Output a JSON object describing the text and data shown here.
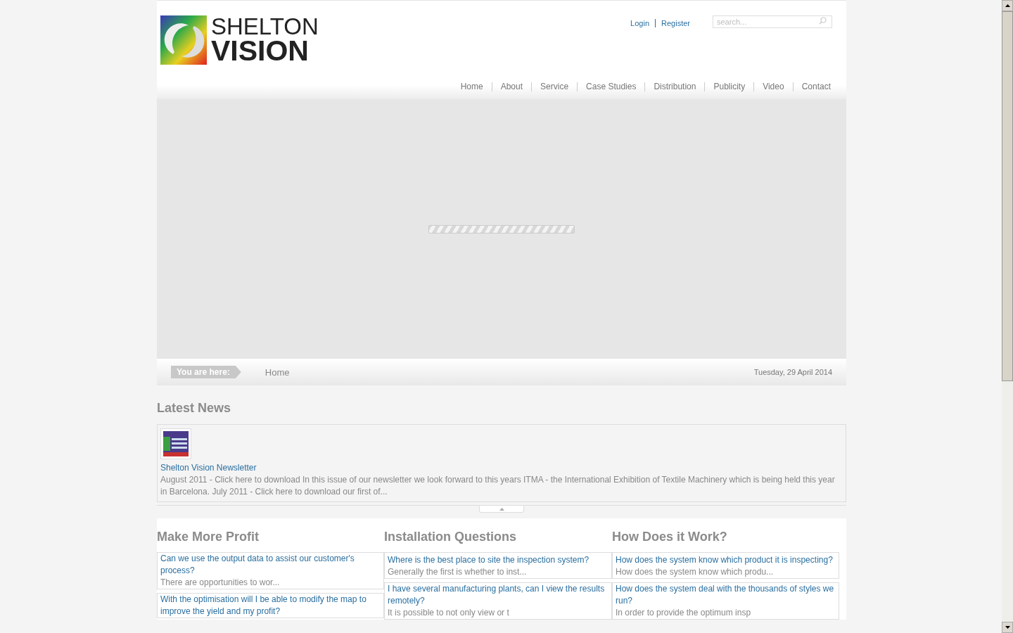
{
  "header": {
    "logo_line_1": "SHELTON",
    "logo_line_2": "VISION",
    "user_links": [
      "Login",
      "Register"
    ],
    "search": {
      "placeholder": "search..."
    }
  },
  "nav": [
    "Home",
    "About",
    "Service",
    "Case Studies",
    "Distribution",
    "Publicity",
    "Video",
    "Contact"
  ],
  "slideshow": {
    "loading": true
  },
  "breadcrumb": {
    "label": "You are here:",
    "items": [
      "Home"
    ],
    "date": "Tuesday, 29 April 2014"
  },
  "latest_news": {
    "title": "Latest News",
    "items": [
      {
        "title": "Shelton Vision Newsletter",
        "summary": "August 2011 - Click here to download In this issue of our newsletter we look forward to this years ITMA - the International Exhibition of Textile Machinery which is being held this year in Barcelona. July 2011 - Click here to download our first of..."
      }
    ]
  },
  "columns": [
    {
      "title": "Make More Profit",
      "items": [
        {
          "question": "Can we use the output data to assist our customer's process?",
          "answer": " There are opportunities to wor..."
        },
        {
          "question": "With the optimisation will I be able to modify the map to improve the yield and my profit?"
        }
      ]
    },
    {
      "title": "Installation Questions",
      "items": [
        {
          "question": "Where is the best place to site the inspection system?",
          "answer": "Generally the first is whether to inst..."
        },
        {
          "question": "I have several manufacturing plants, can I view the results remotely?",
          "answer": "It is possible to not only view or t"
        }
      ]
    },
    {
      "title": "How Does it Work?",
      "items": [
        {
          "question": "How does the system know which product it is inspecting?",
          "answer": "How does the system know which produ..."
        },
        {
          "question": "How does the system deal with the thousands of styles we run?",
          "answer": "In order to provide the optimum insp"
        }
      ]
    }
  ]
}
